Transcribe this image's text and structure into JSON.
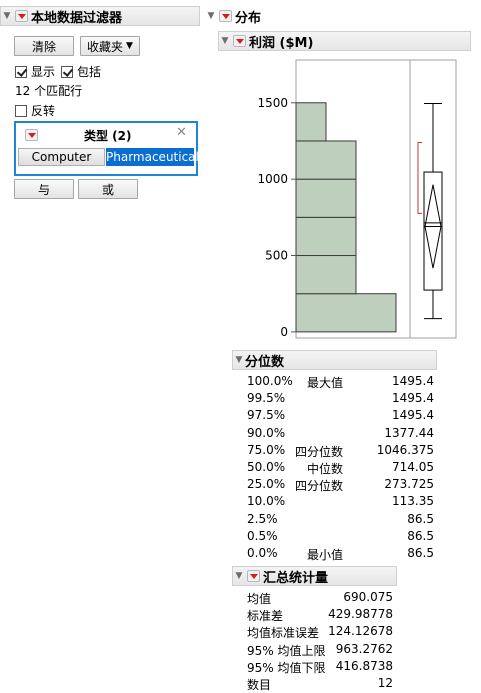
{
  "filter": {
    "title": "本地数据过滤器",
    "clear_label": "清除",
    "favorites_label": "收藏夹",
    "show_label": "显示",
    "include_label": "包括",
    "match_count": "12 个匹配行",
    "invert_label": "反转",
    "column": {
      "title": "类型 (2)",
      "items": [
        "Computer",
        "Pharmaceutical"
      ],
      "selected": "Pharmaceutical"
    },
    "and_label": "与",
    "or_label": "或"
  },
  "distribution": {
    "title": "分布",
    "variable_title": "利润 ($M)"
  },
  "chart_data": {
    "type": "bar",
    "orientation": "horizontal histogram",
    "bins": [
      {
        "from": 0,
        "to": 250,
        "count": 5
      },
      {
        "from": 250,
        "to": 500,
        "count": 3
      },
      {
        "from": 500,
        "to": 750,
        "count": 3
      },
      {
        "from": 750,
        "to": 1000,
        "count": 3
      },
      {
        "from": 1000,
        "to": 1250,
        "count": 3
      },
      {
        "from": 1250,
        "to": 1500,
        "count": 1.5
      }
    ],
    "y_ticks": [
      "0",
      "500",
      "1000",
      "1500"
    ],
    "ylim": [
      -40,
      1780
    ],
    "bar_color": "#bfcfbd",
    "box_plot": {
      "min": 86.5,
      "q1": 273.725,
      "median": 714.05,
      "q3": 1046.375,
      "max": 1495.4,
      "mean": 690.075,
      "ci_low": 416.8738,
      "ci_high": 963.2762,
      "shortest_half": [
        776,
        1240
      ]
    }
  },
  "quantiles": {
    "title": "分位数",
    "rows": [
      {
        "pct": "100.0%",
        "label": "最大值",
        "value": "1495.4"
      },
      {
        "pct": "99.5%",
        "label": "",
        "value": "1495.4"
      },
      {
        "pct": "97.5%",
        "label": "",
        "value": "1495.4"
      },
      {
        "pct": "90.0%",
        "label": "",
        "value": "1377.44"
      },
      {
        "pct": "75.0%",
        "label": "四分位数",
        "value": "1046.375"
      },
      {
        "pct": "50.0%",
        "label": "中位数",
        "value": "714.05"
      },
      {
        "pct": "25.0%",
        "label": "四分位数",
        "value": "273.725"
      },
      {
        "pct": "10.0%",
        "label": "",
        "value": "113.35"
      },
      {
        "pct": "2.5%",
        "label": "",
        "value": "86.5"
      },
      {
        "pct": "0.5%",
        "label": "",
        "value": "86.5"
      },
      {
        "pct": "0.0%",
        "label": "最小值",
        "value": "86.5"
      }
    ]
  },
  "summary": {
    "title": "汇总统计量",
    "rows": [
      {
        "label": "均值",
        "value": "690.075"
      },
      {
        "label": "标准差",
        "value": "429.98778"
      },
      {
        "label": "均值标准误差",
        "value": "124.12678"
      },
      {
        "label": "95% 均值上限",
        "value": "963.2762"
      },
      {
        "label": "95% 均值下限",
        "value": "416.8738"
      },
      {
        "label": "数目",
        "value": "12"
      }
    ]
  },
  "colors": {
    "accent": "#0078d7",
    "selected_bg": "#0a6fd0",
    "red_arrow": "#d81e1e",
    "ci_red": "#c0392b"
  }
}
